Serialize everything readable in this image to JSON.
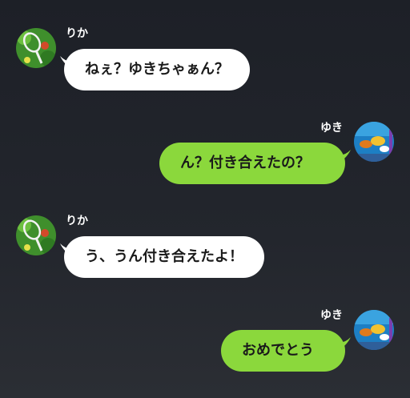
{
  "messages": [
    {
      "side": "left",
      "sender": "りか",
      "text": "ねぇ？ゆきちゃぁん？"
    },
    {
      "side": "right",
      "sender": "ゆき",
      "text": "ん？付き合えたの？"
    },
    {
      "side": "left",
      "sender": "りか",
      "text": "う、うん付き合えたよ！"
    },
    {
      "side": "right",
      "sender": "ゆき",
      "text": "おめでとう"
    }
  ],
  "colors": {
    "background": "#22252c",
    "incoming_bubble": "#ffffff",
    "outgoing_bubble": "#8bd83c",
    "sender_name": "#ffffff"
  },
  "icons": {
    "rika_avatar": "tennis-racket-avatar-icon",
    "yuki_avatar": "aquarium-fish-avatar-icon"
  }
}
